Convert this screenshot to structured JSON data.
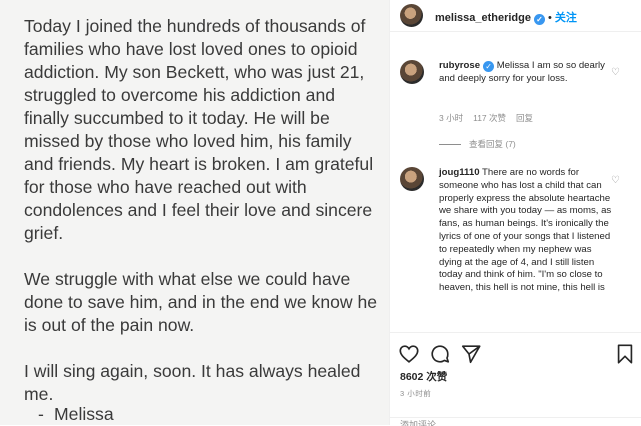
{
  "post": {
    "paragraphs": [
      "Today I joined the hundreds of thousands of families who have lost loved ones to opioid addiction. My son Beckett, who was just 21, struggled to overcome his addiction and finally succumbed to it today. He will be missed by those who loved him, his family and friends. My heart is broken. I am grateful for those who have reached out with condolences and I feel their love and sincere grief.",
      "We struggle with what else we could have done to save him, and in the end we know he is out of the pain now.",
      "I will sing again, soon. It has always healed me."
    ],
    "signoff_dash": "-",
    "signoff_name": "Melissa"
  },
  "header": {
    "username": "melissa_etheridge",
    "verified_glyph": "✓",
    "separator": "•",
    "follow_label": "关注"
  },
  "comments": [
    {
      "username": "rubyrose",
      "verified_glyph": "✓",
      "text": "Melissa I am so so dearly and deeply sorry for your loss.",
      "time": "3 小时",
      "likes": "117 次赞",
      "reply": "回复",
      "view_replies": "查看回复 (7)"
    },
    {
      "username": "joug1110",
      "text": "There are no words for someone who has lost a child that can properly express the absolute heartache we share with you today — as moms, as fans, as human beings. It's ironically the lyrics of one of your songs that I listened to repeatedly when my nephew was dying at the age of 4, and I still listen today and think of him. \"I'm so close to heaven, this hell is not mine, this hell is"
    }
  ],
  "actions": {
    "like_count": "8602 次赞",
    "time_ago": "3 小时前",
    "add_comment_placeholder": "添加评论..."
  },
  "colors": {
    "accent": "#0095f6",
    "verified": "#3897f0",
    "muted": "#8e8e8e",
    "text": "#262626",
    "image_bg": "#f4f4f3"
  }
}
